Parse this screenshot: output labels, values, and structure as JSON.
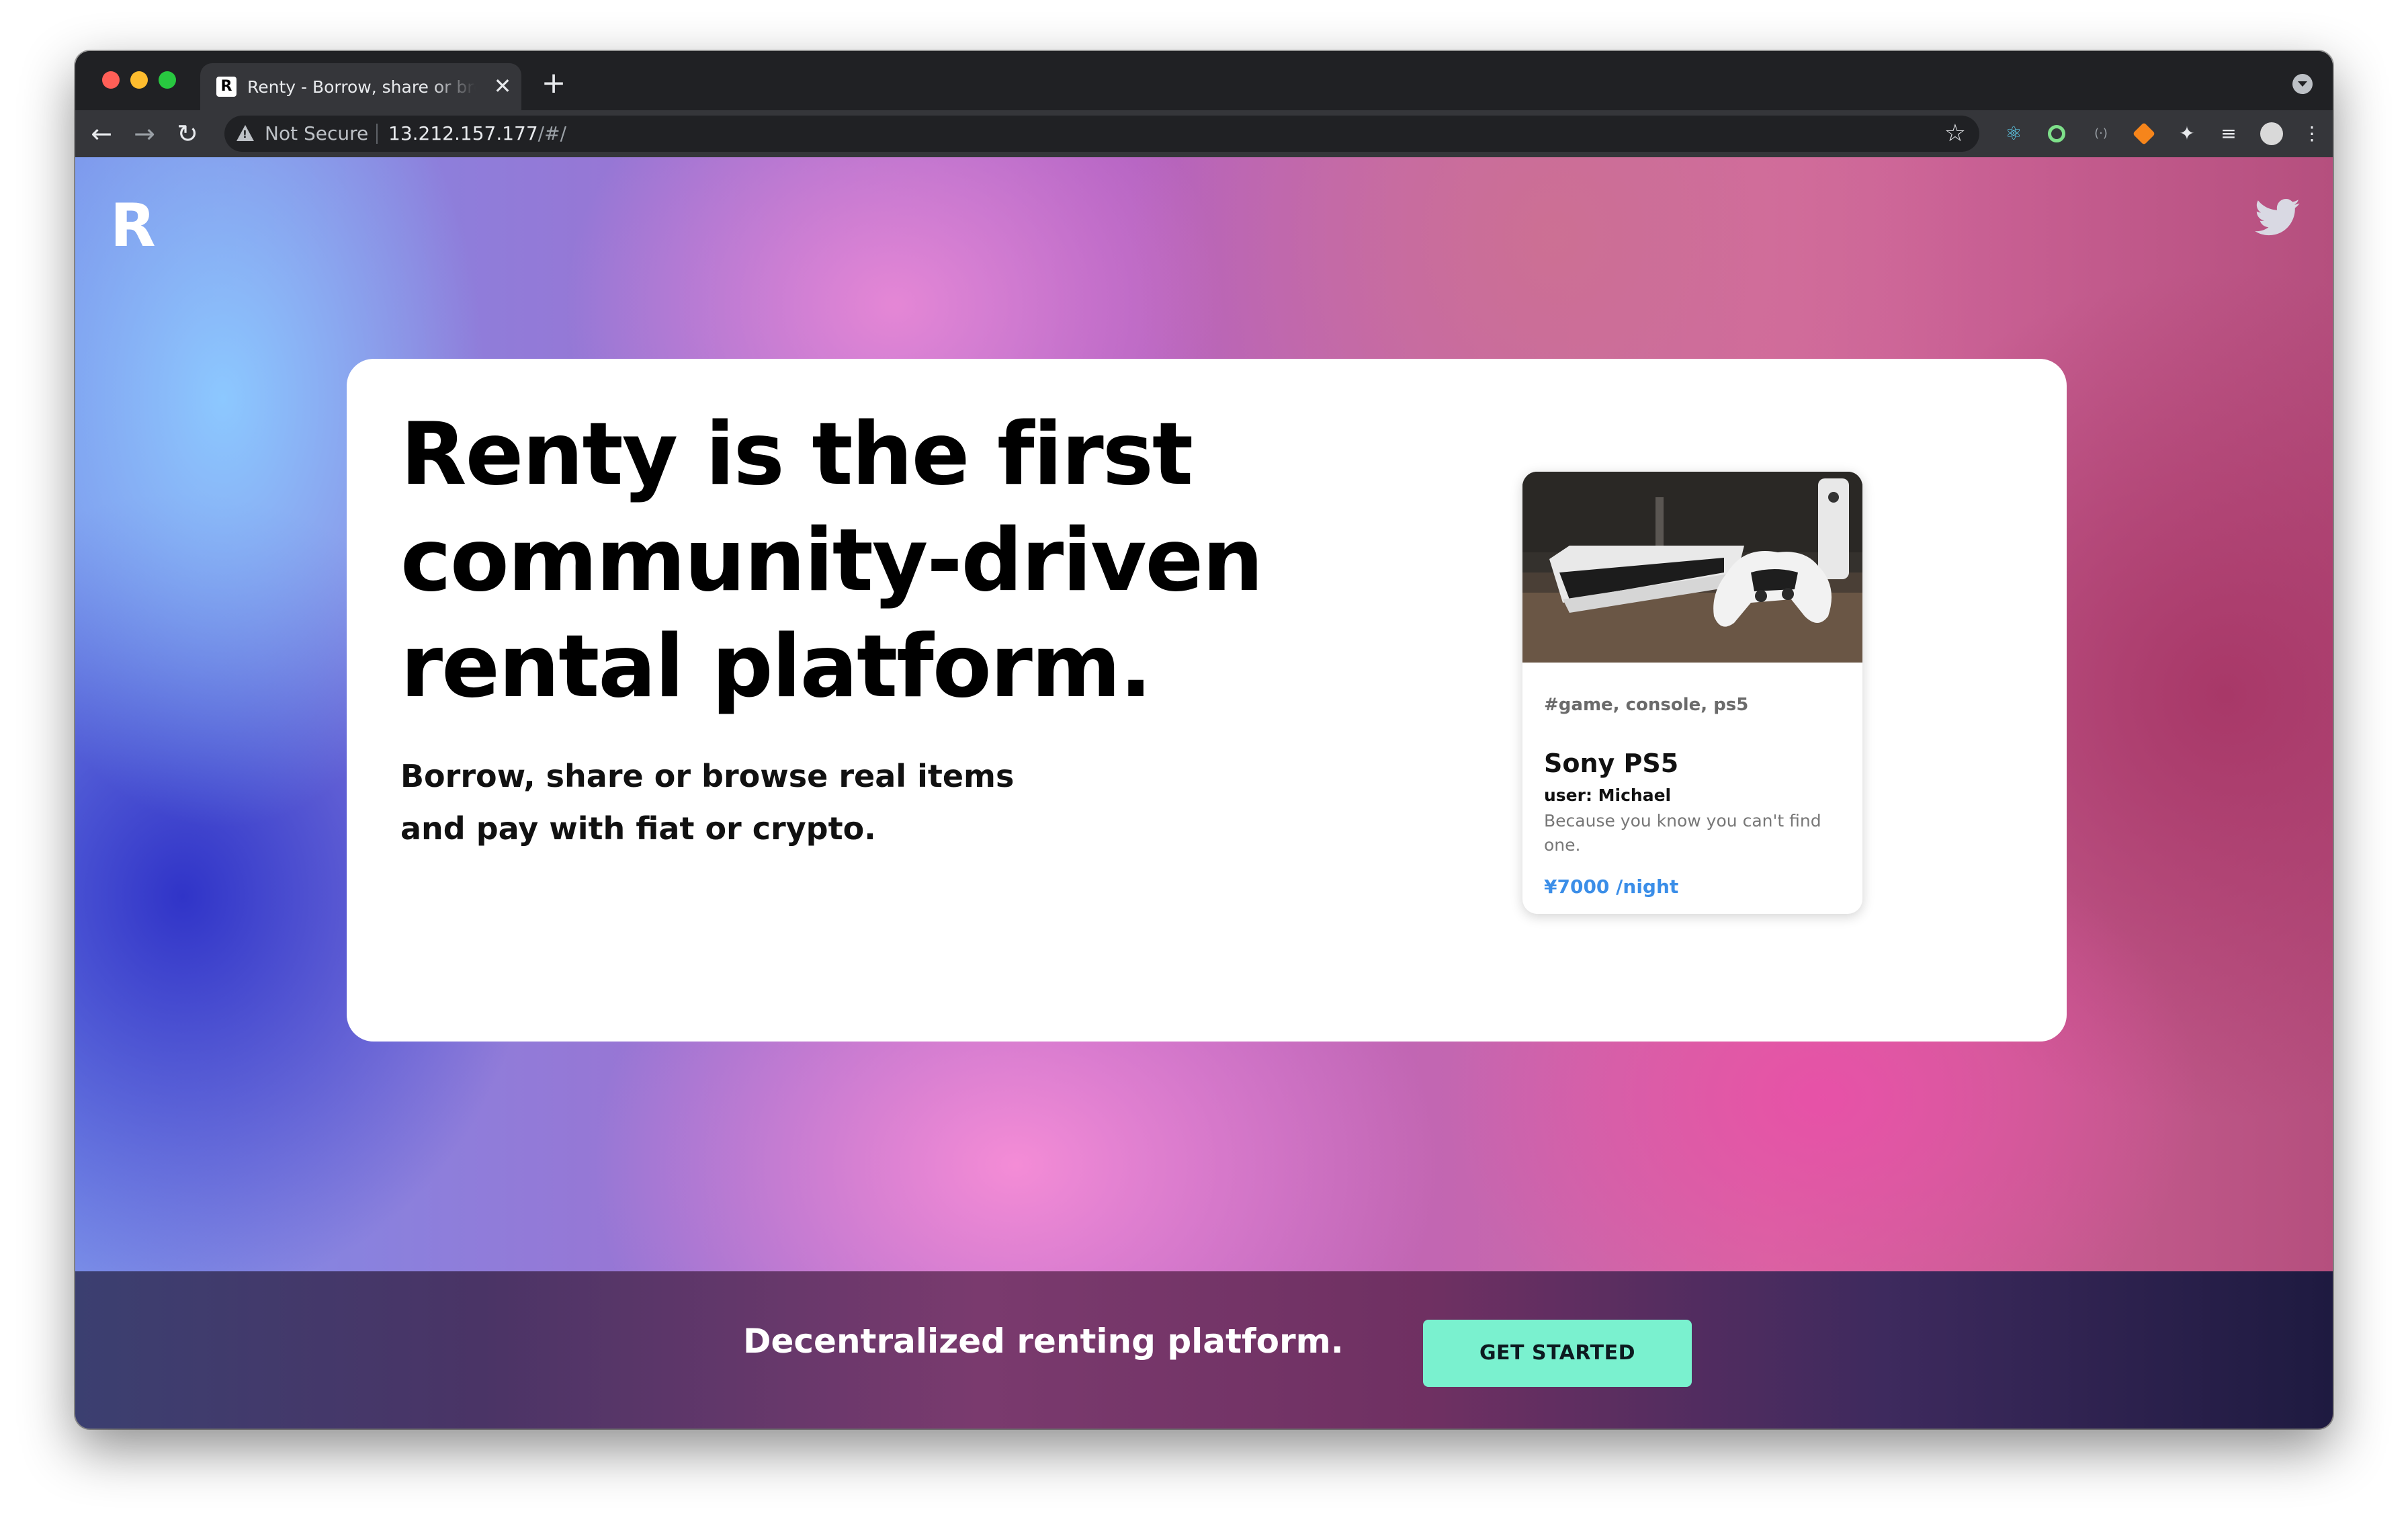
{
  "browser": {
    "tab": {
      "favicon": "R",
      "title": "Renty - Borrow, share or browse real items",
      "close": "✕"
    },
    "new_tab": "+",
    "nav": {
      "back": "←",
      "forward": "→",
      "reload": "↻"
    },
    "address": {
      "security_label": "Not Secure",
      "host": "13.212.157.177",
      "path": "/#/"
    },
    "bookmark": "☆",
    "menu": "⋮",
    "extensions": [
      "react-devtools-icon",
      "green-circle-extension-icon",
      "bracket-extension-icon",
      "metamask-fox-icon",
      "puzzle-extensions-icon",
      "reading-list-icon",
      "profile-avatar-icon"
    ]
  },
  "site": {
    "logo": "R",
    "hero": {
      "title_lines": [
        "Renty is the first",
        "community-driven",
        "rental platform."
      ],
      "subtitle_lines": [
        "Borrow, share or browse real items",
        "and pay with fiat or crypto."
      ]
    },
    "item": {
      "tags": "#game, console, ps5",
      "title": "Sony PS5",
      "user": "user: Michael",
      "description": "Because you know you can't find one.",
      "price": "¥7000 /night"
    },
    "footer": {
      "tagline": "Decentralized renting platform.",
      "cta": "GET STARTED"
    }
  }
}
